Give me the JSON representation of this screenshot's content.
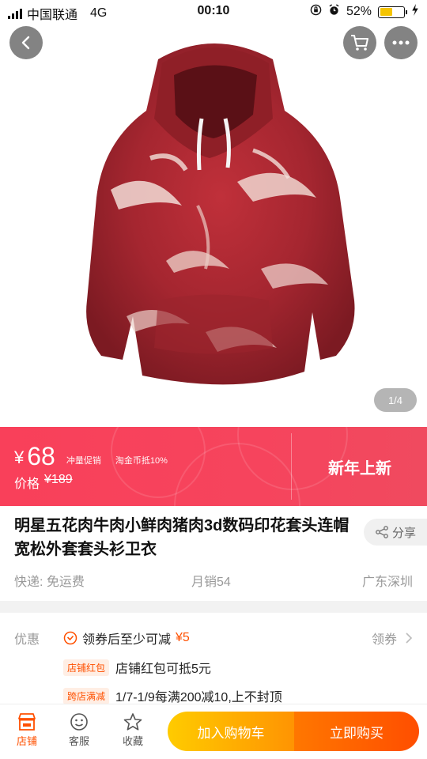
{
  "status_bar": {
    "carrier": "中国联通",
    "network": "4G",
    "time": "00:10",
    "battery_percent": "52%",
    "battery_level": 0.52
  },
  "gallery": {
    "image_alt": "hoodie",
    "page_indicator": "1/4"
  },
  "price_banner": {
    "currency": "¥",
    "price": "68",
    "tags": [
      "冲量促销",
      "淘金币抵10%"
    ],
    "original_label": "价格",
    "original_price": "¥189",
    "promo_text": "新年上新",
    "colors": {
      "background": "#f6445d",
      "text": "#ffffff"
    }
  },
  "product": {
    "title": "明星五花肉牛肉小鲜肉猪肉3d数码印花套头连帽宽松外套套头衫卫衣",
    "share_label": "分享",
    "shipping": "快递: 免运费",
    "monthly_sales": "月销54",
    "location": "广东深圳"
  },
  "coupons": {
    "label": "优惠",
    "coupon_text": "领券后至少可减",
    "coupon_amount": "¥5",
    "claim_label": "领券",
    "rows": [
      {
        "tag": "店铺红包",
        "text": "店铺红包可抵5元"
      },
      {
        "tag": "跨店满减",
        "text": "1/7-1/9每满200减10,上不封顶"
      }
    ]
  },
  "bottom_bar": {
    "shop_label": "店铺",
    "service_label": "客服",
    "favorite_label": "收藏",
    "add_to_cart_label": "加入购物车",
    "buy_now_label": "立即购买",
    "accent_color": "#ff5000"
  }
}
